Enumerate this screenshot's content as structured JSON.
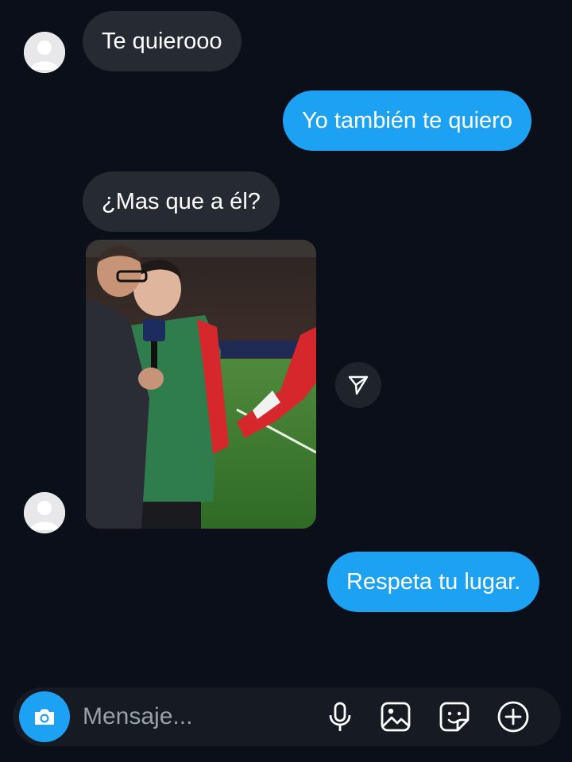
{
  "messages": [
    {
      "direction": "incoming",
      "text": "Te quierooo"
    },
    {
      "direction": "outgoing",
      "text": "Yo también te quiero"
    },
    {
      "direction": "incoming",
      "text": "¿Mas que a él?"
    },
    {
      "direction": "incoming",
      "type": "video",
      "description_icon": "shared-video-thumbnail"
    },
    {
      "direction": "outgoing",
      "text": "Respeta tu lugar."
    }
  ],
  "composer": {
    "placeholder": "Mensaje...",
    "icons": [
      "camera-icon",
      "microphone-icon",
      "gallery-icon",
      "sticker-icon",
      "plus-icon"
    ]
  },
  "colors": {
    "background": "#0b0f19",
    "incoming_bubble": "#262a33",
    "outgoing_bubble": "#1da1f2",
    "accent": "#1da1f2"
  }
}
